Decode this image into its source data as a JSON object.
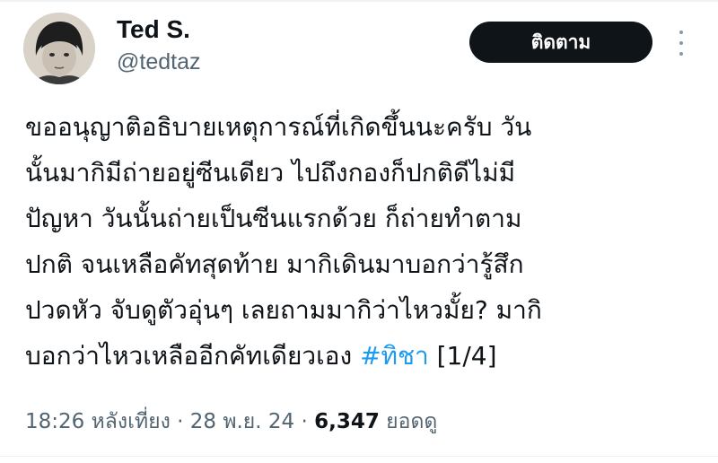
{
  "author": {
    "display_name": "Ted S.",
    "handle": "@tedtaz"
  },
  "follow_button": {
    "label": "ติดตาม"
  },
  "more_menu": {
    "icon": "more-vertical-icon"
  },
  "tweet": {
    "lines": [
      "ขออนุญาติอธิบายเหตุการณ์ที่เกิดขึ้นนะครับ วัน",
      "นั้นมากิมีถ่ายอยู่ซีนเดียว ไปถึงกองก็ปกติดีไม่มี",
      "ปัญหา วันนั้นถ่ายเป็นซีนแรกด้วย ก็ถ่ายทำตาม",
      "ปกติ จนเหลือคัทสุดท้าย มากิเดินมาบอกว่ารู้สึก",
      "ปวดหัว จับดูตัวอุ่นๆ เลยถามมากิว่าไหวมั้ย? มากิ"
    ],
    "last_line_prefix": "บอกว่าไหวเหลืออีกคัทเดียวเอง ",
    "hashtag": "#ทิชา",
    "last_line_suffix": " [1/4]"
  },
  "meta": {
    "time": "18:26 หลังเที่ยง",
    "separator": " · ",
    "date": "28 พ.ย. 24",
    "views_count": "6,347",
    "views_label": " ยอดดู"
  },
  "colors": {
    "text": "#0f1419",
    "secondary": "#536471",
    "link": "#1d9bf0",
    "button_bg": "#0f1419"
  }
}
